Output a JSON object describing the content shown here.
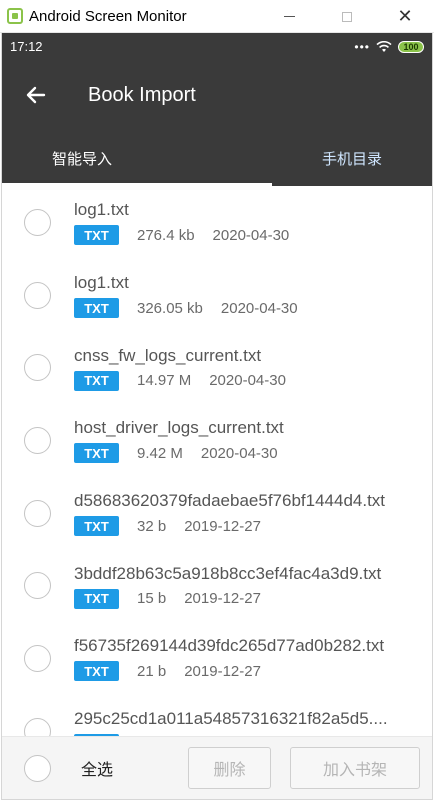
{
  "window": {
    "title": "Android Screen Monitor",
    "close_glyph": "✕"
  },
  "status_bar": {
    "time": "17:12",
    "dots": "•••",
    "battery": "100"
  },
  "app_bar": {
    "title": "Book Import"
  },
  "tabs": [
    {
      "label": "智能导入",
      "active": true
    },
    {
      "label": "手机目录",
      "active": false
    }
  ],
  "files": [
    {
      "name": "log1.txt",
      "type": "TXT",
      "size": "276.4 kb",
      "date": "2020-04-30"
    },
    {
      "name": "log1.txt",
      "type": "TXT",
      "size": "326.05 kb",
      "date": "2020-04-30"
    },
    {
      "name": "cnss_fw_logs_current.txt",
      "type": "TXT",
      "size": "14.97 M",
      "date": "2020-04-30"
    },
    {
      "name": "host_driver_logs_current.txt",
      "type": "TXT",
      "size": "9.42 M",
      "date": "2020-04-30"
    },
    {
      "name": "d58683620379fadaebae5f76bf1444d4.txt",
      "type": "TXT",
      "size": "32 b",
      "date": "2019-12-27"
    },
    {
      "name": "3bddf28b63c5a918b8cc3ef4fac4a3d9.txt",
      "type": "TXT",
      "size": "15 b",
      "date": "2019-12-27"
    },
    {
      "name": "f56735f269144d39fdc265d77ad0b282.txt",
      "type": "TXT",
      "size": "21 b",
      "date": "2019-12-27"
    },
    {
      "name": "295c25cd1a011a54857316321f82a5d5....",
      "type": "TXT",
      "size": "",
      "date": ""
    }
  ],
  "bottom_bar": {
    "select_all": "全选",
    "delete": "删除",
    "add_to_shelf": "加入书架"
  },
  "colors": {
    "app_bar": "#3a3a3a",
    "badge": "#1e9be6",
    "battery": "#8bc34a"
  }
}
